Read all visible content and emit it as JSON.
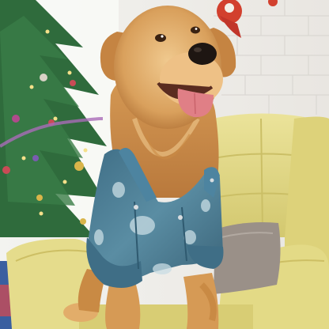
{
  "scene": {
    "subject": "golden-retriever",
    "apparel": "denim-jacket",
    "props": [
      "christmas-tree",
      "yellow-armchair",
      "grey-cushion",
      "wall-ornament"
    ],
    "palette": {
      "wall": "#efeeeb",
      "brick_line": "#d9d6d1",
      "window": "#f6f7f3",
      "chair": "#e4dc8a",
      "chair_shadow": "#c9be63",
      "fur": "#d69a55",
      "fur_light": "#f0c98e",
      "fur_dark": "#b27337",
      "denim": "#4e7f96",
      "denim_light": "#8fb6c4",
      "tree": "#2f6b3c",
      "cushion": "#9a9088",
      "tongue": "#e07f86",
      "ornament_red": "#d2402e"
    }
  }
}
